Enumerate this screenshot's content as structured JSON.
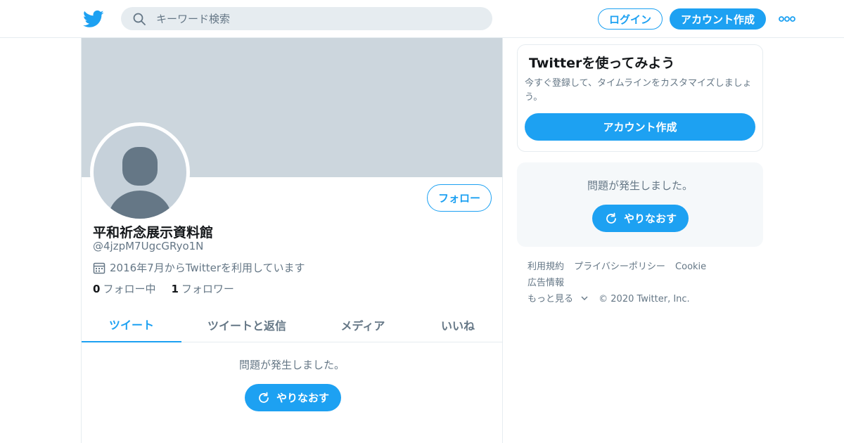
{
  "header": {
    "search_placeholder": "キーワード検索",
    "login_label": "ログイン",
    "signup_label": "アカウント作成"
  },
  "profile": {
    "name": "平和祈念展示資料館",
    "handle": "@4jzpM7UgcGRyo1N",
    "joined": "2016年7月からTwitterを利用しています",
    "following_count": "0",
    "following_label": "フォロー中",
    "followers_count": "1",
    "followers_label": "フォロワー",
    "follow_label": "フォロー"
  },
  "tabs": [
    {
      "label": "ツイート",
      "active": true
    },
    {
      "label": "ツイートと返信",
      "active": false
    },
    {
      "label": "メディア",
      "active": false
    },
    {
      "label": "いいね",
      "active": false
    }
  ],
  "timeline": {
    "error_text": "問題が発生しました。",
    "retry_label": "やりなおす"
  },
  "sidebar": {
    "card_title": "Twitterを使ってみよう",
    "card_text": "今すぐ登録して、タイムラインをカスタマイズしましょう。",
    "card_button": "アカウント作成",
    "error_text": "問題が発生しました。",
    "retry_label": "やりなおす"
  },
  "footer": {
    "links": [
      "利用規約",
      "プライバシーポリシー",
      "Cookie",
      "広告情報",
      "もっと見る"
    ],
    "copyright": "© 2020 Twitter, Inc."
  },
  "colors": {
    "accent": "#1da1f2",
    "banner": "#ccd6dd",
    "muted_text": "#657786"
  }
}
